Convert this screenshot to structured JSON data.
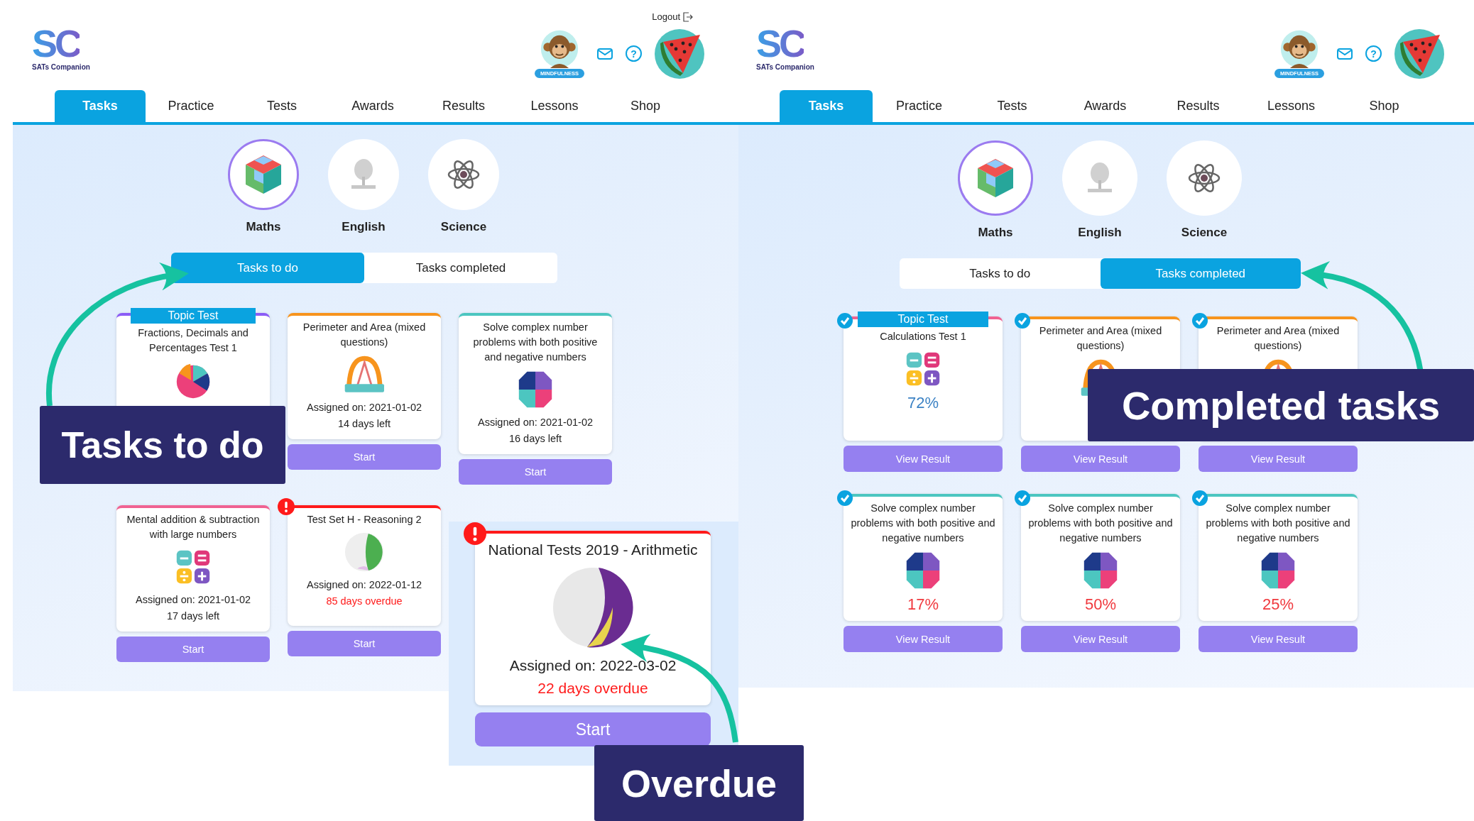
{
  "panels": [
    {
      "logo": {
        "mark": "SC",
        "name": "SATs Companion"
      },
      "logout": "Logout",
      "avatar_badge": "MINDFULNESS",
      "help": "?",
      "nav": [
        {
          "label": "Tasks",
          "selected": true
        },
        {
          "label": "Practice",
          "selected": false
        },
        {
          "label": "Tests",
          "selected": false
        },
        {
          "label": "Awards",
          "selected": false
        },
        {
          "label": "Results",
          "selected": false
        },
        {
          "label": "Lessons",
          "selected": false
        },
        {
          "label": "Shop",
          "selected": false
        }
      ],
      "subjects": [
        {
          "label": "Maths",
          "kind": "cube",
          "selected": true
        },
        {
          "label": "English",
          "kind": "tree",
          "selected": false
        },
        {
          "label": "Science",
          "kind": "atom",
          "selected": false
        }
      ],
      "task_tabs": [
        {
          "label": "Tasks to do",
          "selected": true
        },
        {
          "label": "Tasks completed",
          "selected": false
        }
      ],
      "cards": [
        {
          "badge": "Topic Test",
          "title": "Fractions, Decimals and Percentages Test 1",
          "kind": "pie",
          "color": "#8b5cf6",
          "completed": false,
          "overdue": false
        },
        {
          "title": "Perimeter and Area (mixed questions)",
          "kind": "protractor",
          "assigned": "Assigned on: 2021-01-02",
          "due": "14 days left",
          "color": "#f7941d",
          "completed": false,
          "overdue": false,
          "button": "Start"
        },
        {
          "title": "Solve complex number problems with both positive and negative numbers",
          "kind": "numbers",
          "assigned": "Assigned on: 2021-01-02",
          "due": "16 days left",
          "color": "#4cc6c0",
          "completed": false,
          "overdue": false,
          "button": "Start"
        },
        {
          "title": "Mental addition & subtraction with large numbers",
          "kind": "operations",
          "assigned": "Assigned on: 2021-01-02",
          "due": "17 days left",
          "color": "#f06292",
          "completed": false,
          "overdue": false,
          "button": "Start"
        },
        {
          "title": "Test Set H - Reasoning 2",
          "kind": "test-set",
          "assigned": "Assigned on: 2022-01-12",
          "due": "85 days overdue",
          "color": "#ff1a1a",
          "completed": false,
          "overdue": true,
          "button": "Start"
        }
      ]
    },
    {
      "logo": {
        "mark": "SC",
        "name": "SATs Companion"
      },
      "avatar_badge": "MINDFULNESS",
      "help": "?",
      "nav": [
        {
          "label": "Tasks",
          "selected": true
        },
        {
          "label": "Practice",
          "selected": false
        },
        {
          "label": "Tests",
          "selected": false
        },
        {
          "label": "Awards",
          "selected": false
        },
        {
          "label": "Results",
          "selected": false
        },
        {
          "label": "Lessons",
          "selected": false
        },
        {
          "label": "Shop",
          "selected": false
        }
      ],
      "subjects": [
        {
          "label": "Maths",
          "kind": "cube",
          "selected": true
        },
        {
          "label": "English",
          "kind": "tree",
          "selected": false
        },
        {
          "label": "Science",
          "kind": "atom",
          "selected": false
        }
      ],
      "task_tabs": [
        {
          "label": "Tasks to do",
          "selected": false
        },
        {
          "label": "Tasks completed",
          "selected": true
        }
      ],
      "cards": [
        {
          "badge": "Topic Test",
          "title": "Calculations Test 1",
          "kind": "operations",
          "score": {
            "text": "72%",
            "color": "#3b82c4"
          },
          "color": "#f06292",
          "completed": true,
          "overdue": false,
          "button": "View Result"
        },
        {
          "title": "Perimeter and Area (mixed questions)",
          "kind": "protractor",
          "color": "#f7941d",
          "completed": true,
          "overdue": false,
          "button": "View Result"
        },
        {
          "title": "Perimeter and Area (mixed questions)",
          "kind": "protractor",
          "color": "#f7941d",
          "completed": true,
          "overdue": false,
          "button": "View Result"
        },
        {
          "title": "Solve complex number problems with both positive and negative numbers",
          "kind": "numbers",
          "score": {
            "text": "17%",
            "color": "#f0383d"
          },
          "color": "#4cc6c0",
          "completed": true,
          "overdue": false,
          "button": "View Result"
        },
        {
          "title": "Solve complex number problems with both positive and negative numbers",
          "kind": "numbers",
          "score": {
            "text": "50%",
            "color": "#f0383d"
          },
          "color": "#4cc6c0",
          "completed": true,
          "overdue": false,
          "button": "View Result"
        },
        {
          "title": "Solve complex number problems with both positive and negative numbers",
          "kind": "numbers",
          "score": {
            "text": "25%",
            "color": "#f0383d"
          },
          "color": "#4cc6c0",
          "completed": true,
          "overdue": false,
          "button": "View Result"
        }
      ]
    }
  ],
  "zoomed_card": {
    "title": "National Tests 2019 - Arithmetic",
    "kind": "national-test",
    "assigned": "Assigned on: 2022-03-02",
    "due": "22 days overdue",
    "color": "#ff1a1a",
    "overdue": true,
    "button": "Start"
  },
  "callouts": [
    {
      "text": "Tasks to do",
      "kind": "tasks"
    },
    {
      "text": "Completed tasks",
      "kind": "completed"
    },
    {
      "text": "Overdue",
      "kind": "overdue"
    }
  ]
}
